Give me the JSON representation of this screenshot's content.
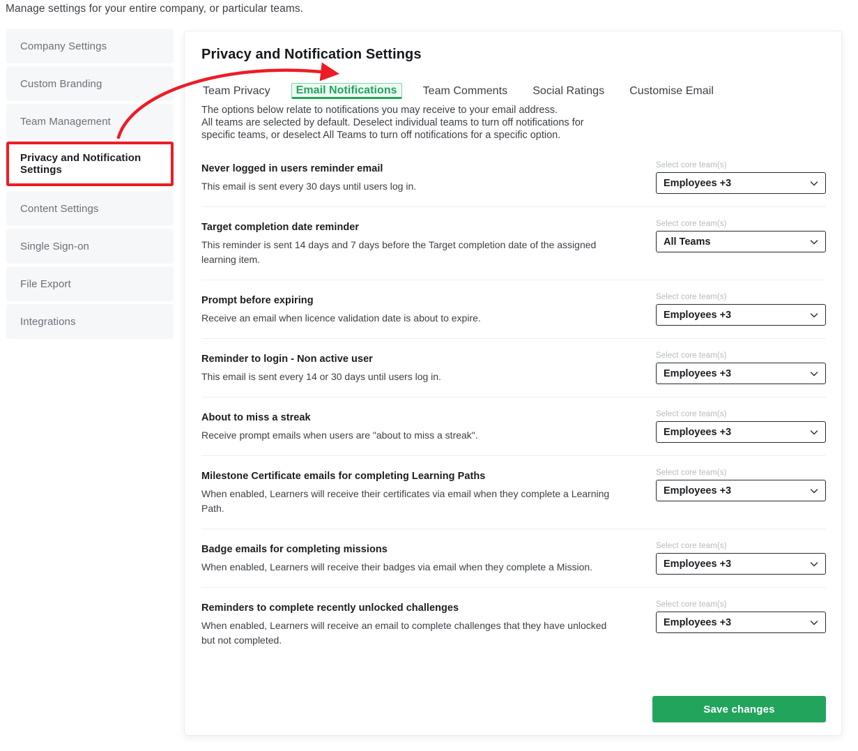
{
  "intro": "Manage settings for your entire company, or particular teams.",
  "sidebar": {
    "items": [
      {
        "label": "Company Settings",
        "active": false
      },
      {
        "label": "Custom Branding",
        "active": false
      },
      {
        "label": "Team Management",
        "active": false
      },
      {
        "label": "Privacy and Notification Settings",
        "active": true
      },
      {
        "label": "Content Settings",
        "active": false
      },
      {
        "label": "Single Sign-on",
        "active": false
      },
      {
        "label": "File Export",
        "active": false
      },
      {
        "label": "Integrations",
        "active": false
      }
    ]
  },
  "card": {
    "title": "Privacy and Notification Settings",
    "tabs": [
      {
        "label": "Team Privacy",
        "active": false
      },
      {
        "label": "Email Notifications",
        "active": true
      },
      {
        "label": "Team Comments",
        "active": false
      },
      {
        "label": "Social Ratings",
        "active": false
      },
      {
        "label": "Customise Email",
        "active": false
      }
    ],
    "description_lines": [
      "The options below relate to notifications you may receive to your email address.",
      "All teams are selected by default. Deselect individual teams to turn off notifications for",
      "specific teams, or deselect All Teams to turn off notifications for a specific option."
    ],
    "select_label": "Select core team(s)",
    "rows": [
      {
        "title": "Never logged in users reminder email",
        "subtitle": "This email is sent every 30 days until users log in.",
        "select_label": "Select core team(s)",
        "select_value": "Employees +3"
      },
      {
        "title": "Target completion date reminder",
        "subtitle": "This reminder is sent 14 days and 7 days before the Target completion date of the assigned learning item.",
        "select_label": "Select core team(s)",
        "select_value": "All Teams"
      },
      {
        "title": "Prompt before expiring",
        "subtitle": "Receive an email when licence validation date is about to expire.",
        "select_label": "Select core team(s)",
        "select_value": "Employees +3"
      },
      {
        "title": "Reminder to login - Non active user",
        "subtitle": "This email is sent every 14 or 30 days until users log in.",
        "select_label": "Select core team(s)",
        "select_value": "Employees +3"
      },
      {
        "title": "About to miss a streak",
        "subtitle": "Receive prompt emails when users are \"about to miss a streak\".",
        "select_label": "Select core team(s)",
        "select_value": "Employees +3"
      },
      {
        "title": "Milestone Certificate emails for completing Learning Paths",
        "subtitle": "When enabled, Learners will receive their certificates via email when they complete a Learning Path.",
        "select_label": "Select core team(s)",
        "select_value": "Employees +3"
      },
      {
        "title": "Badge emails for completing missions",
        "subtitle": "When enabled, Learners will receive their badges via email when they complete a Mission.",
        "select_label": "Select core team(s)",
        "select_value": "Employees +3"
      },
      {
        "title": "Reminders to complete recently unlocked challenges",
        "subtitle": "When enabled, Learners will receive an email to complete challenges that they have unlocked but not completed.",
        "select_label": "Select core team(s)",
        "select_value": "Employees +3"
      }
    ],
    "save_label": "Save changes"
  },
  "colors": {
    "accent_green": "#22a45d",
    "annotation_red": "#ed1c24",
    "sidebar_item_bg": "#f6f7f9",
    "text_dark": "#1b1d21",
    "text_muted": "#6b7077"
  }
}
